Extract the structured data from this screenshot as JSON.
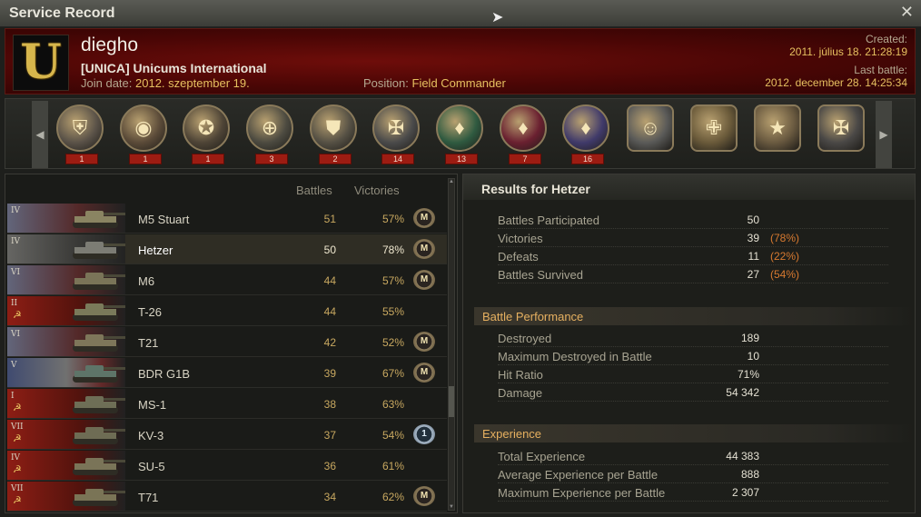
{
  "window": {
    "title": "Service Record"
  },
  "profile": {
    "clan_logo_letter": "U",
    "player_name": "diegho",
    "clan_tag": "[UNICA]",
    "clan_name": "Unicums International",
    "join_label": "Join date:",
    "join_date": "2012. szeptember 19.",
    "position_label": "Position:",
    "position": "Field Commander",
    "created_label": "Created:",
    "created": "2011. július 18. 21:28:19",
    "last_battle_label": "Last battle:",
    "last_battle": "2012. december 28. 14:25:34"
  },
  "medals": [
    {
      "icon": "tank-expert-medal-icon",
      "glyph": "⛨",
      "count": "1",
      "color": "#5a5248"
    },
    {
      "icon": "raider-medal-icon",
      "glyph": "◉",
      "count": "1",
      "color": "#5a4a38"
    },
    {
      "icon": "invader-medal-icon",
      "glyph": "✪",
      "count": "1",
      "color": "#4e4436"
    },
    {
      "icon": "sniper-medal-icon",
      "glyph": "⊕",
      "count": "3",
      "color": "#4c4a40"
    },
    {
      "icon": "steel-wall-medal-icon",
      "glyph": "⛊",
      "count": "2",
      "color": "#555044"
    },
    {
      "icon": "wot-medal-icon",
      "glyph": "✠",
      "count": "14",
      "color": "#4a4a4a"
    },
    {
      "icon": "confederate-medal-icon",
      "glyph": "♦",
      "count": "13",
      "color": "#2f5a40"
    },
    {
      "icon": "scout-medal-icon",
      "glyph": "♦",
      "count": "7",
      "color": "#6a2030"
    },
    {
      "icon": "patrol-duty-medal-icon",
      "glyph": "♦",
      "count": "16",
      "color": "#403a6a"
    },
    {
      "icon": "hero-portrait-medal-icon",
      "glyph": "☺",
      "count": "",
      "color": "#5a5a58"
    },
    {
      "icon": "cross-portrait-medal-icon",
      "glyph": "✙",
      "count": "",
      "color": "#6a5a3a"
    },
    {
      "icon": "star-portrait-medal-icon",
      "glyph": "★",
      "count": "",
      "color": "#6a5a40"
    },
    {
      "icon": "iron-cross-portrait-medal-icon",
      "glyph": "✠",
      "count": "",
      "color": "#4a4846"
    }
  ],
  "vehicles_header": {
    "battles": "Battles",
    "victories": "Victories"
  },
  "vehicles": [
    {
      "tier": "IV",
      "nation": "usa",
      "name": "M5 Stuart",
      "battles": "51",
      "wins": "57%",
      "badge": "M",
      "tank_color": "#8a8462"
    },
    {
      "tier": "IV",
      "nation": "germany",
      "name": "Hetzer",
      "battles": "50",
      "wins": "78%",
      "badge": "M",
      "tank_color": "#7c7c74"
    },
    {
      "tier": "VI",
      "nation": "usa",
      "name": "M6",
      "battles": "44",
      "wins": "57%",
      "badge": "M",
      "tank_color": "#7a7458"
    },
    {
      "tier": "II",
      "nation": "ussr",
      "name": "T-26",
      "battles": "44",
      "wins": "55%",
      "badge": "",
      "tank_color": "#7a7a5a"
    },
    {
      "tier": "VI",
      "nation": "usa",
      "name": "T21",
      "battles": "42",
      "wins": "52%",
      "badge": "M",
      "tank_color": "#7e765a"
    },
    {
      "tier": "V",
      "nation": "france",
      "name": "BDR G1B",
      "battles": "39",
      "wins": "67%",
      "badge": "M",
      "tank_color": "#5e7468"
    },
    {
      "tier": "I",
      "nation": "ussr",
      "name": "MS-1",
      "battles": "38",
      "wins": "63%",
      "badge": "",
      "tank_color": "#6e6e56"
    },
    {
      "tier": "VII",
      "nation": "ussr",
      "name": "KV-3",
      "battles": "37",
      "wins": "54%",
      "badge": "1",
      "tank_color": "#6e6c54"
    },
    {
      "tier": "IV",
      "nation": "ussr",
      "name": "SU-5",
      "battles": "36",
      "wins": "61%",
      "badge": "",
      "tank_color": "#7a7458"
    },
    {
      "tier": "VII",
      "nation": "ussr",
      "name": "T71",
      "battles": "34",
      "wins": "62%",
      "badge": "M",
      "tank_color": "#7a7456"
    }
  ],
  "results": {
    "title": "Results for Hetzer",
    "general": [
      {
        "label": "Battles Participated",
        "value": "50",
        "pct": ""
      },
      {
        "label": "Victories",
        "value": "39",
        "pct": "(78%)"
      },
      {
        "label": "Defeats",
        "value": "11",
        "pct": "(22%)"
      },
      {
        "label": "Battles Survived",
        "value": "27",
        "pct": "(54%)"
      }
    ],
    "performance_title": "Battle Performance",
    "performance": [
      {
        "label": "Destroyed",
        "value": "189",
        "pct": ""
      },
      {
        "label": "Maximum Destroyed in Battle",
        "value": "10",
        "pct": ""
      },
      {
        "label": "Hit Ratio",
        "value": "71%",
        "pct": ""
      },
      {
        "label": "Damage",
        "value": "54 342",
        "pct": ""
      }
    ],
    "experience_title": "Experience",
    "experience": [
      {
        "label": "Total Experience",
        "value": "44 383",
        "pct": ""
      },
      {
        "label": "Average Experience per Battle",
        "value": "888",
        "pct": ""
      },
      {
        "label": "Maximum Experience per Battle",
        "value": "2 307",
        "pct": ""
      }
    ]
  }
}
